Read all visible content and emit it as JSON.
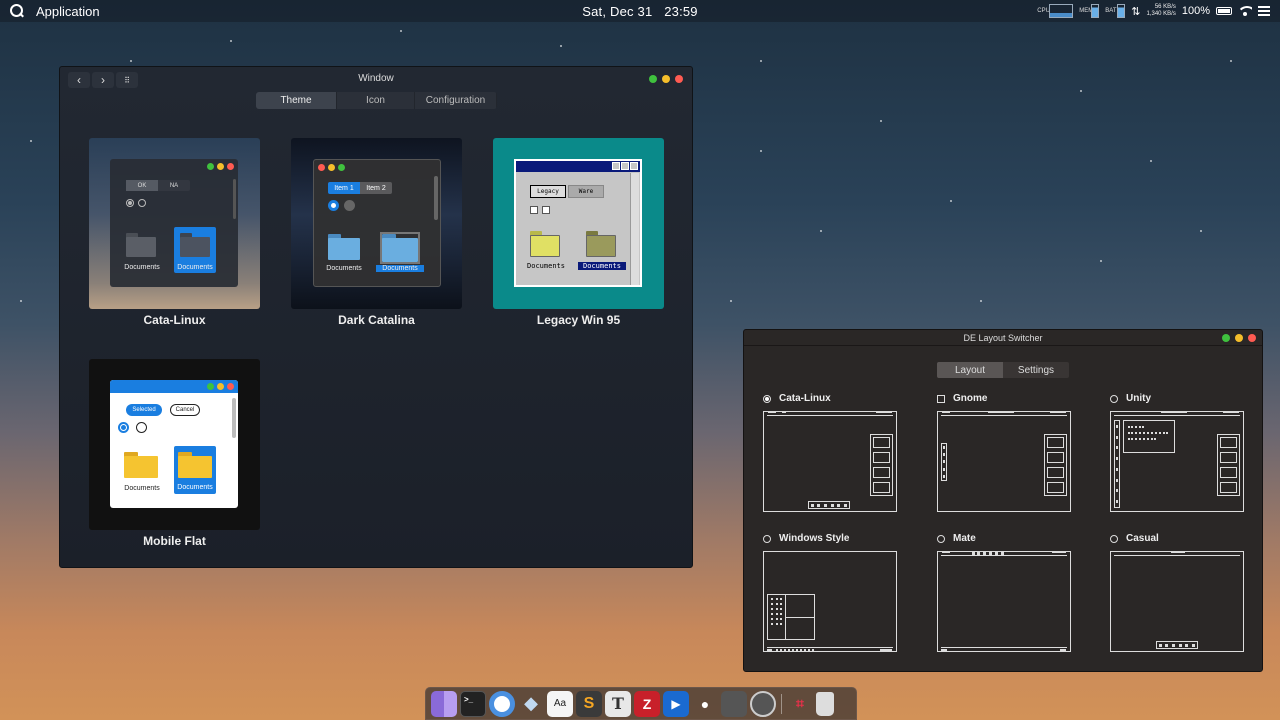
{
  "topbar": {
    "app_name": "Application",
    "date": "Sat, Dec 31",
    "time": "23:59",
    "cpu_label": "CPU",
    "mem_label": "MEM",
    "bat_label": "BAT",
    "net_up": "56 KB/s",
    "net_down": "1,340 KB/s",
    "battery_percent": "100%"
  },
  "main_window": {
    "title": "Window",
    "tabs": [
      {
        "label": "Theme",
        "active": true
      },
      {
        "label": "Icon",
        "active": false
      },
      {
        "label": "Configuration",
        "active": false
      }
    ],
    "themes": [
      {
        "name": "Cata-Linux",
        "button_a": "OK",
        "button_b": "NA",
        "folder_a": "Documents",
        "folder_b": "Documents"
      },
      {
        "name": "Dark Catalina",
        "button_a": "Item 1",
        "button_b": "Item 2",
        "folder_a": "Documents",
        "folder_b": "Documents"
      },
      {
        "name": "Legacy Win 95",
        "button_a": "Legacy",
        "button_b": "Ware",
        "folder_a": "Documents",
        "folder_b": "Documents"
      },
      {
        "name": "Mobile Flat",
        "button_a": "Selected",
        "button_b": "Cancel",
        "folder_a": "Documents",
        "folder_b": "Documents"
      }
    ]
  },
  "de_window": {
    "title": "DE Layout Switcher",
    "tabs": [
      {
        "label": "Layout",
        "active": true
      },
      {
        "label": "Settings",
        "active": false
      }
    ],
    "layouts": [
      {
        "name": "Cata-Linux",
        "control": "radio",
        "selected": true
      },
      {
        "name": "Gnome",
        "control": "checkbox",
        "selected": false
      },
      {
        "name": "Unity",
        "control": "radio",
        "selected": false
      },
      {
        "name": "Windows Style",
        "control": "radio",
        "selected": false
      },
      {
        "name": "Mate",
        "control": "radio",
        "selected": false
      },
      {
        "name": "Casual",
        "control": "radio",
        "selected": false
      }
    ]
  },
  "dock": {
    "items": [
      "finder-icon",
      "terminal-icon",
      "chromium-icon",
      "sketch-icon",
      "font-book-icon",
      "sublime-text-icon",
      "typora-icon",
      "filezilla-icon",
      "video-editor-icon",
      "github-icon",
      "calculator-icon",
      "system-settings-icon",
      "screenshot-crop-icon",
      "trash-icon"
    ],
    "font_book_label": "Aa",
    "typora_label": "T"
  },
  "colors": {
    "accent_blue": "#1a7ee0",
    "traffic_green": "#3fc13e",
    "traffic_yellow": "#f5be2b",
    "traffic_red": "#ff5b52",
    "legacy_teal": "#0a8a8a",
    "legacy_navy": "#0a1a7a"
  }
}
